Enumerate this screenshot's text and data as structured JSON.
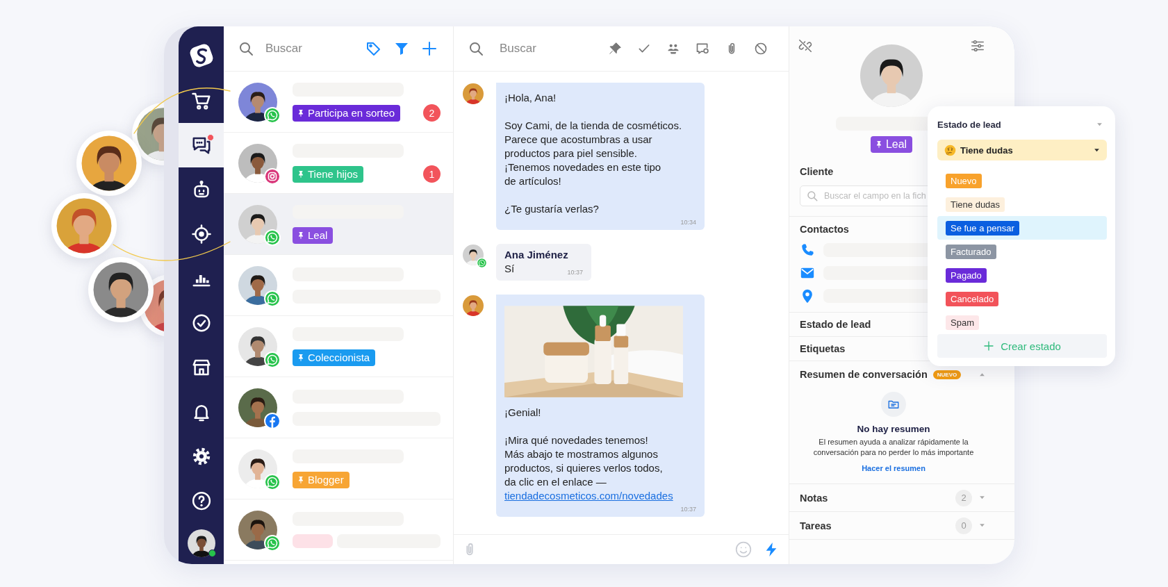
{
  "sidebar": {
    "items": [
      {
        "selected": false,
        "notification": false
      },
      {
        "selected": true,
        "notification": true
      },
      {
        "selected": false,
        "notification": false
      },
      {
        "selected": false,
        "notification": false
      },
      {
        "selected": false,
        "notification": false
      },
      {
        "selected": false,
        "notification": false
      },
      {
        "selected": false,
        "notification": false
      },
      {
        "selected": false,
        "notification": false
      },
      {
        "selected": false,
        "notification": false
      },
      {
        "selected": false,
        "notification": false
      }
    ],
    "user": {
      "online": true
    }
  },
  "chat_list": {
    "search": {
      "placeholder": "Buscar"
    },
    "conversations": [
      {
        "selected": false,
        "badge": {
          "kind": "whatsapp"
        },
        "tag": {
          "label": "Participa en sorteo",
          "color": "#6a2bd9"
        },
        "unread": "2"
      },
      {
        "selected": false,
        "badge": {
          "kind": "instagram"
        },
        "tag": {
          "label": "Tiene hijos",
          "color": "#2ec48b"
        },
        "unread": "1"
      },
      {
        "selected": true,
        "badge": {
          "kind": "whatsapp"
        },
        "tag": {
          "label": "Leal",
          "color": "#8a4fe0"
        }
      },
      {
        "selected": false,
        "badge": {
          "kind": "whatsapp"
        }
      },
      {
        "selected": false,
        "badge": {
          "kind": "whatsapp"
        },
        "tag": {
          "label": "Coleccionista",
          "color": "#1a9bf0"
        }
      },
      {
        "selected": false,
        "badge": {
          "kind": "facebook"
        }
      },
      {
        "selected": false,
        "badge": {
          "kind": "whatsapp"
        },
        "tag": {
          "label": "Blogger",
          "color": "#f7a534"
        }
      },
      {
        "selected": false,
        "badge": {
          "kind": "whatsapp"
        },
        "pending_tag": true
      }
    ]
  },
  "chat": {
    "search": {
      "placeholder": "Buscar"
    },
    "messages": [
      {
        "kind": "outgoing",
        "text": "¡Hola, Ana!\n\nSoy Cami, de la tienda de cosméticos.\nParece que acostumbras a usar\nproductos para piel sensible.\n¡Tenemos novedades en este tipo\nde artículos!\n\n¿Te gustaría verlas?",
        "time": "10:34"
      },
      {
        "kind": "incoming",
        "author": "Ana Jiménez",
        "text": "Sí",
        "time": "10:37",
        "badge": {
          "kind": "whatsapp"
        }
      },
      {
        "kind": "outgoing",
        "text": "¡Genial!\n\n¡Mira qué novedades tenemos!\nMás abajo te mostramos algunos\nproductos, si quieres verlos todos,\nda clic en el enlace —",
        "link": "tiendadecosmeticos.com/novedades",
        "time": "10:37"
      }
    ]
  },
  "contact_panel": {
    "tag": {
      "label": "Leal",
      "color": "#8a4fe0"
    },
    "sections": [
      {
        "kind": "search",
        "title": "Cliente",
        "placeholder": "Buscar el campo en la fich"
      },
      {
        "kind": "contacts",
        "title": "Contactos"
      },
      {
        "kind": "row",
        "title": "Estado de lead"
      },
      {
        "kind": "row",
        "title": "Etiquetas"
      },
      {
        "kind": "summary",
        "title": "Resumen de conversación",
        "badge": "NUEVO",
        "expanded": true,
        "empty_title": "No hay resumen",
        "empty_text": "El resumen ayuda a analizar rápidamente la\nconversación para no perder lo más importante",
        "action": "Hacer el resumen"
      },
      {
        "kind": "count",
        "title": "Notas",
        "count": "2",
        "expanded": false
      },
      {
        "kind": "count",
        "title": "Tareas",
        "count": "0",
        "expanded": false
      }
    ]
  },
  "lead_status_menu": {
    "title": "Estado de lead",
    "value": "Tiene dudas",
    "options": [
      {
        "label": "Nuevo",
        "color": "#f8a22c",
        "highlighted": false
      },
      {
        "label": "Tiene dudas",
        "color": "#fdf0dd",
        "highlighted": false
      },
      {
        "label": "Se fue a pensar",
        "color": "#0b5fe0",
        "highlighted": true
      },
      {
        "label": "Facturado",
        "color": "#8c95a3",
        "highlighted": false
      },
      {
        "label": "Pagado",
        "color": "#6a2bd9",
        "highlighted": false
      },
      {
        "label": "Cancelado",
        "color": "#f2535a",
        "highlighted": false
      },
      {
        "label": "Spam",
        "color": "#fde7e9",
        "highlighted": false
      }
    ],
    "create_label": "Crear estado"
  }
}
